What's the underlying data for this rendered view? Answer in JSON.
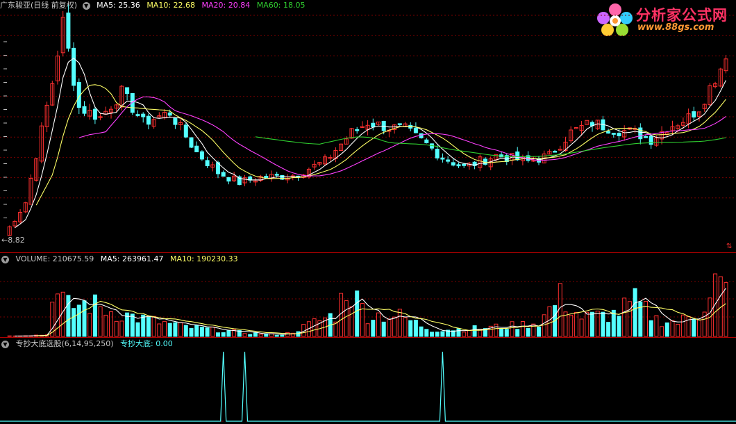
{
  "price_header": {
    "title": "广东骏亚(日线 前复权)",
    "ma5": "MA5: 25.36",
    "ma10": "MA10: 22.68",
    "ma20": "MA20: 20.84",
    "ma60": "MA60: 18.05"
  },
  "price_low_label": "←8.82",
  "volume_header": {
    "title": "VOLUME: 210675.59",
    "ma5": "MA5: 263961.47",
    "ma10": "MA10: 190230.33"
  },
  "indicator_header": {
    "title": "专抄大底选股(6,14,95,250)",
    "value": "专抄大底: 0.00"
  },
  "logo": {
    "name": "分析家公式网",
    "url_text": "www.88gs.com"
  },
  "colors": {
    "up": "#ff3030",
    "down": "#54ffff",
    "ma5": "#ffffff",
    "ma10": "#ffff66",
    "ma20": "#ff40ff",
    "ma60": "#30d030",
    "separator": "#b00000"
  },
  "chart_data": {
    "type": "candlestick",
    "price_range_low": 8.82,
    "price_waypoints": [
      {
        "i": 0,
        "p": 9.2
      },
      {
        "i": 4,
        "p": 12.5
      },
      {
        "i": 9,
        "p": 24.5
      },
      {
        "i": 11,
        "p": 30.5
      },
      {
        "i": 14,
        "p": 22
      },
      {
        "i": 18,
        "p": 21
      },
      {
        "i": 22,
        "p": 23.5
      },
      {
        "i": 26,
        "p": 20.5
      },
      {
        "i": 31,
        "p": 21.5
      },
      {
        "i": 36,
        "p": 17.5
      },
      {
        "i": 40,
        "p": 15.5
      },
      {
        "i": 44,
        "p": 14.5
      },
      {
        "i": 48,
        "p": 15
      },
      {
        "i": 54,
        "p": 15.2
      },
      {
        "i": 60,
        "p": 16.6
      },
      {
        "i": 65,
        "p": 19.5
      },
      {
        "i": 68,
        "p": 20.5
      },
      {
        "i": 72,
        "p": 20
      },
      {
        "i": 75,
        "p": 19.8
      },
      {
        "i": 79,
        "p": 18.3
      },
      {
        "i": 82,
        "p": 17
      },
      {
        "i": 86,
        "p": 16
      },
      {
        "i": 92,
        "p": 17.2
      },
      {
        "i": 98,
        "p": 16.6
      },
      {
        "i": 102,
        "p": 17.2
      },
      {
        "i": 106,
        "p": 19.5
      },
      {
        "i": 110,
        "p": 20.5
      },
      {
        "i": 114,
        "p": 19.8
      },
      {
        "i": 118,
        "p": 19.5
      },
      {
        "i": 121,
        "p": 18.8
      },
      {
        "i": 124,
        "p": 20
      },
      {
        "i": 128,
        "p": 21
      },
      {
        "i": 130,
        "p": 22
      },
      {
        "i": 132,
        "p": 24
      },
      {
        "i": 134,
        "p": 26
      },
      {
        "i": 135,
        "p": 27.5
      }
    ],
    "volume_waypoints": [
      {
        "i": 0,
        "v": 2000
      },
      {
        "i": 8,
        "v": 10000
      },
      {
        "i": 9,
        "v": 340000
      },
      {
        "i": 10,
        "v": 250000
      },
      {
        "i": 12,
        "v": 190000
      },
      {
        "i": 16,
        "v": 210000
      },
      {
        "i": 20,
        "v": 160000
      },
      {
        "i": 26,
        "v": 110000
      },
      {
        "i": 34,
        "v": 60000
      },
      {
        "i": 46,
        "v": 20000
      },
      {
        "i": 52,
        "v": 10000
      },
      {
        "i": 54,
        "v": 30000
      },
      {
        "i": 58,
        "v": 90000
      },
      {
        "i": 62,
        "v": 140000
      },
      {
        "i": 64,
        "v": 320000
      },
      {
        "i": 68,
        "v": 140000
      },
      {
        "i": 74,
        "v": 130000
      },
      {
        "i": 80,
        "v": 40000
      },
      {
        "i": 88,
        "v": 50000
      },
      {
        "i": 96,
        "v": 70000
      },
      {
        "i": 100,
        "v": 90000
      },
      {
        "i": 104,
        "v": 250000
      },
      {
        "i": 108,
        "v": 120000
      },
      {
        "i": 114,
        "v": 140000
      },
      {
        "i": 118,
        "v": 220000
      },
      {
        "i": 122,
        "v": 110000
      },
      {
        "i": 126,
        "v": 90000
      },
      {
        "i": 130,
        "v": 150000
      },
      {
        "i": 133,
        "v": 370000
      },
      {
        "i": 135,
        "v": 280000
      }
    ],
    "signal_spikes": [
      41,
      45,
      82
    ]
  }
}
